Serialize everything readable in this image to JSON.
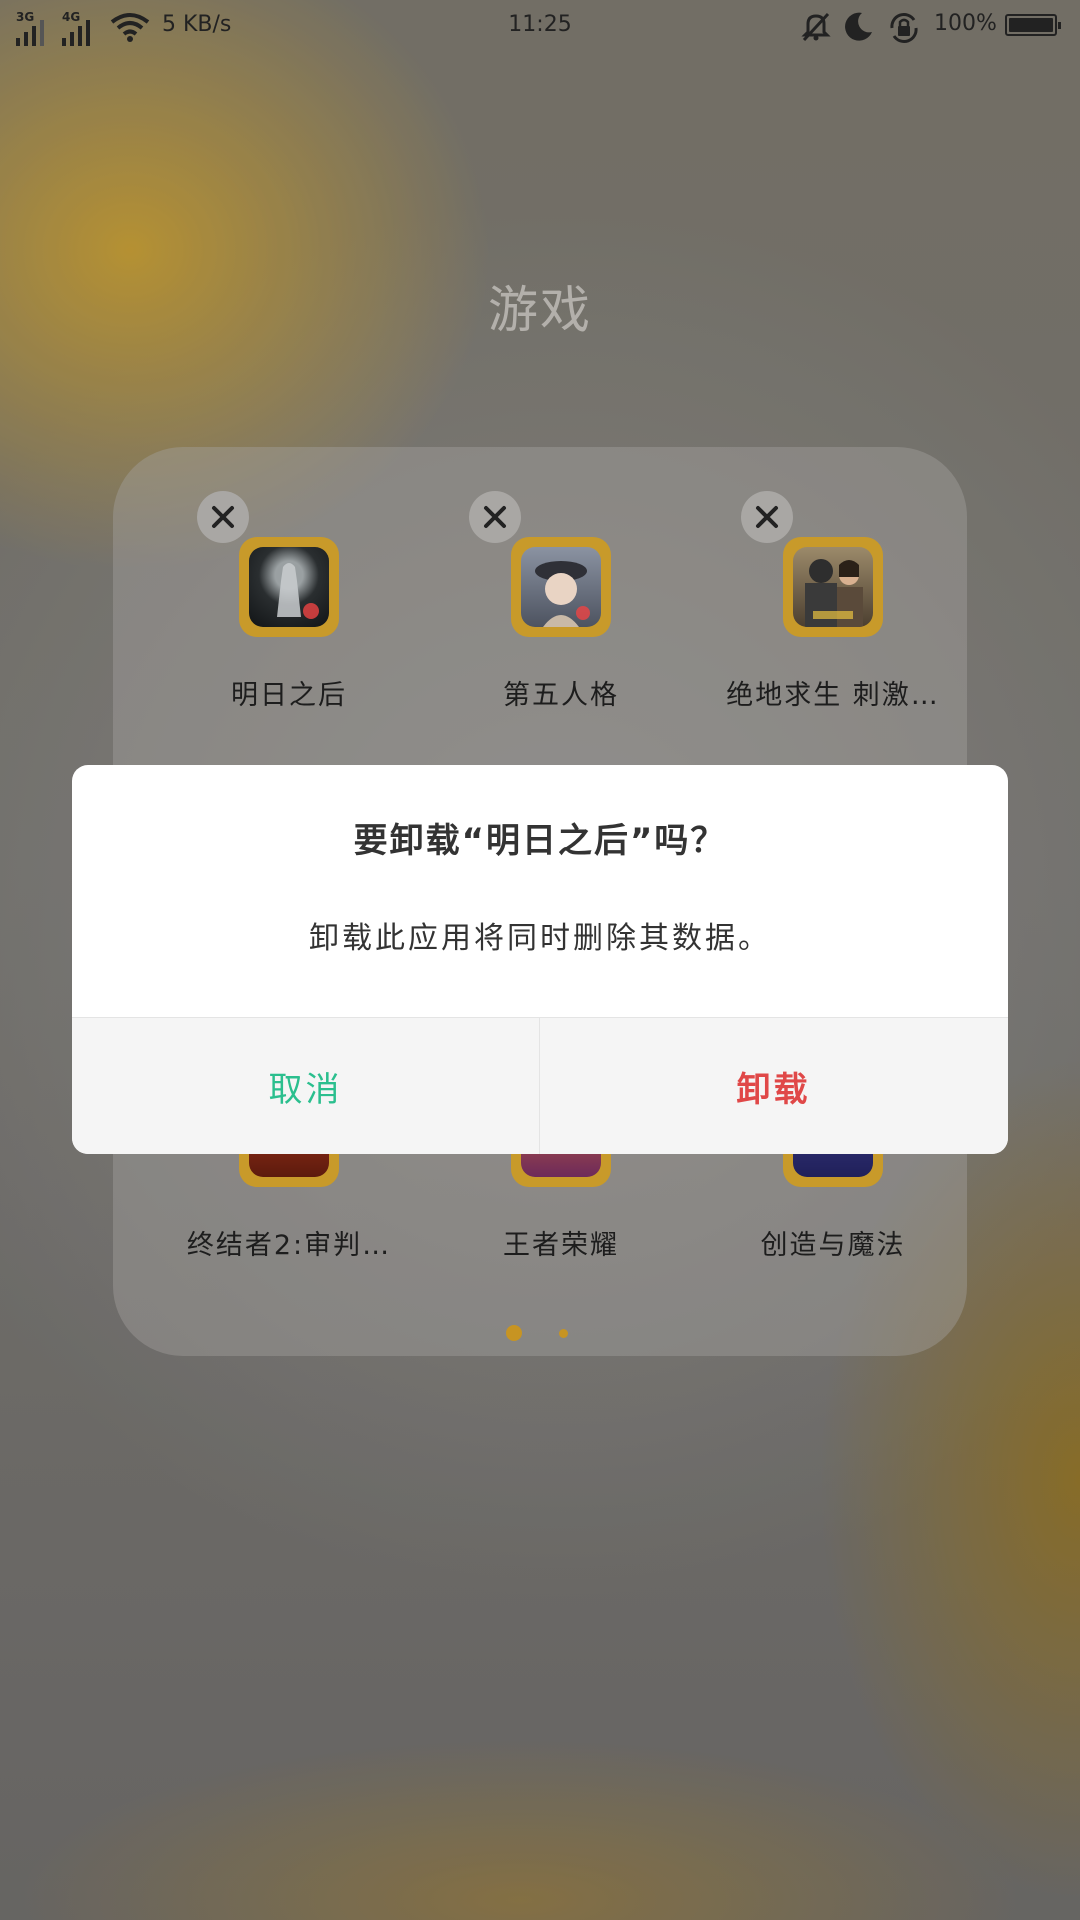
{
  "status_bar": {
    "net1": "3G",
    "net2": "4G",
    "speed": "5 KB/s",
    "time": "11:25",
    "battery": "100%",
    "icons": [
      "mute-icon",
      "moon-icon",
      "rotation-lock-icon",
      "battery-icon"
    ]
  },
  "folder": {
    "title": "游戏",
    "apps": [
      {
        "label": "明日之后"
      },
      {
        "label": "第五人格"
      },
      {
        "label": "绝地求生 刺激…"
      },
      {
        "label": "终结者2:审判…"
      },
      {
        "label": "王者荣耀"
      },
      {
        "label": "创造与魔法"
      }
    ],
    "pages": 2,
    "current_page": 1
  },
  "dialog": {
    "title": "要卸载“明日之后”吗？",
    "message": "卸载此应用将同时删除其数据。",
    "cancel_label": "取消",
    "confirm_label": "卸载"
  },
  "colors": {
    "cancel": "#2bbf8e",
    "confirm": "#e04848",
    "accent": "#c79422"
  }
}
